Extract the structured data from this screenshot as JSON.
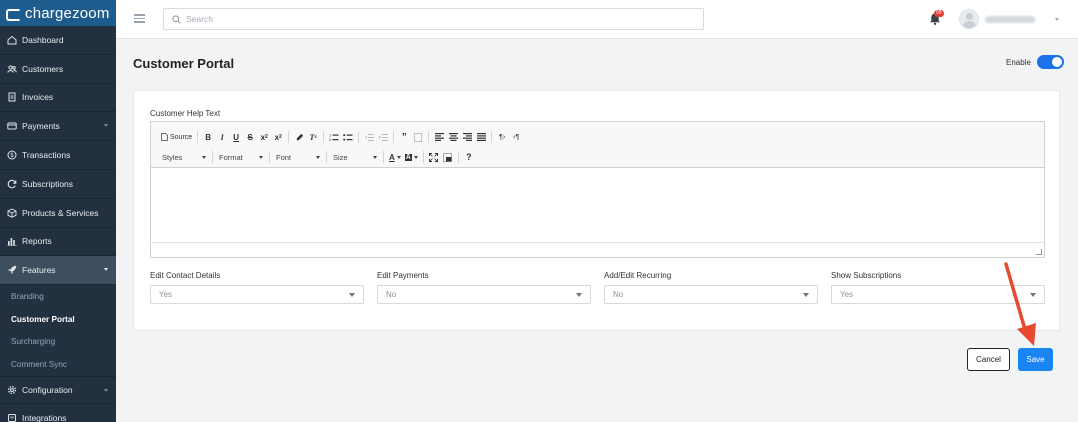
{
  "brand": {
    "name": "chargezoom"
  },
  "topbar": {
    "search_placeholder": "Search",
    "notification_count": "99"
  },
  "sidebar": {
    "items": [
      {
        "label": "Dashboard",
        "icon": "home-icon"
      },
      {
        "label": "Customers",
        "icon": "users-icon"
      },
      {
        "label": "Invoices",
        "icon": "invoice-icon"
      },
      {
        "label": "Payments",
        "icon": "card-icon"
      },
      {
        "label": "Transactions",
        "icon": "dollar-icon"
      },
      {
        "label": "Subscriptions",
        "icon": "refresh-icon"
      },
      {
        "label": "Products & Services",
        "icon": "box-icon"
      },
      {
        "label": "Reports",
        "icon": "chart-icon"
      },
      {
        "label": "Features",
        "icon": "rocket-icon"
      }
    ],
    "sub_items": [
      "Branding",
      "Customer Portal",
      "Surcharging",
      "Comment Sync"
    ],
    "bottom_items": [
      {
        "label": "Configuration",
        "icon": "gear-icon"
      },
      {
        "label": "Integrations",
        "icon": "plug-icon"
      }
    ]
  },
  "page": {
    "title": "Customer Portal",
    "enable_label": "Enable",
    "enabled": true,
    "help_text_label": "Customer Help Text"
  },
  "editor": {
    "source_label": "Source",
    "combos": [
      "Styles",
      "Format",
      "Font",
      "Size"
    ]
  },
  "fields": [
    {
      "label": "Edit Contact Details",
      "value": "Yes"
    },
    {
      "label": "Edit Payments",
      "value": "No"
    },
    {
      "label": "Add/Edit Recurring",
      "value": "No"
    },
    {
      "label": "Show Subscriptions",
      "value": "Yes"
    }
  ],
  "actions": {
    "cancel": "Cancel",
    "save": "Save"
  },
  "colors": {
    "accent": "#1a84f3",
    "sidebar": "#233040",
    "annotation": "#e84a2f"
  }
}
